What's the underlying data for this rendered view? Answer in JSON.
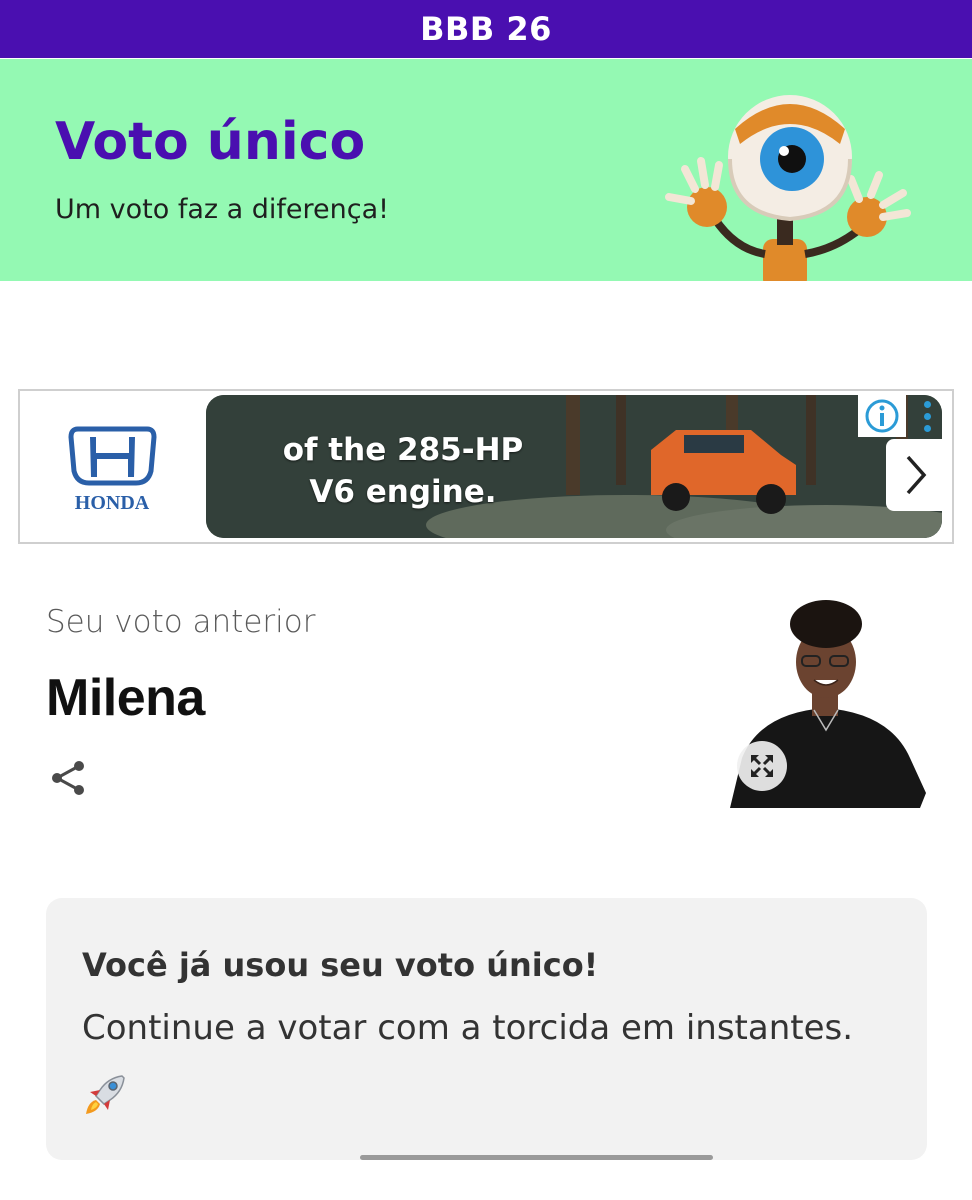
{
  "topbar": {
    "title": "BBB 26"
  },
  "hero": {
    "title": "Voto único",
    "subtitle": "Um voto faz a diferença!",
    "mascot_icon": "big-brother-eye-mascot"
  },
  "ad": {
    "brand": "HONDA",
    "headline_line1": "of the 285-HP",
    "headline_line2": "V6 engine.",
    "info_icon": "info-icon",
    "menu_icon": "more-vert-icon",
    "next_icon": "chevron-right-icon"
  },
  "previous_vote": {
    "label": "Seu voto anterior",
    "name": "Milena",
    "share_icon": "share-icon",
    "expand_icon": "expand-icon"
  },
  "notice": {
    "title": "Você já usou seu voto único!",
    "message": "Continue a votar com a torcida em instantes.",
    "emoji_icon": "rocket-icon"
  },
  "colors": {
    "brand_purple": "#4a0fb0",
    "hero_green": "#94f9b3",
    "honda_blue": "#2a5fa8",
    "card_bg": "#f2f2f2"
  }
}
